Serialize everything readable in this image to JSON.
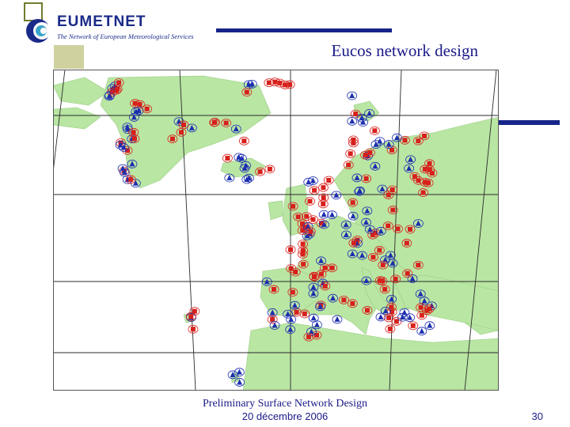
{
  "logo": {
    "wordmark": "EUMETNET",
    "tagline": "The Network of European Meteorological Services"
  },
  "slide": {
    "title": "Eucos network design",
    "footer_title": "Preliminary Surface Network Design",
    "footer_date": "20 décembre 2006",
    "page_number": "30"
  },
  "map": {
    "description_icons": [
      "station-marker-red-square",
      "station-marker-blue-triangle"
    ],
    "colors": {
      "sea": "#ffffff",
      "land": "#b9e6a3",
      "grid": "#2b2b2b",
      "red_marker": "#d8201c",
      "blue_marker": "#1c2fb0"
    }
  },
  "colors": {
    "accent_bar": "#17248a",
    "deco_square": "#cfd29f",
    "title_text": "#1a1a88"
  }
}
